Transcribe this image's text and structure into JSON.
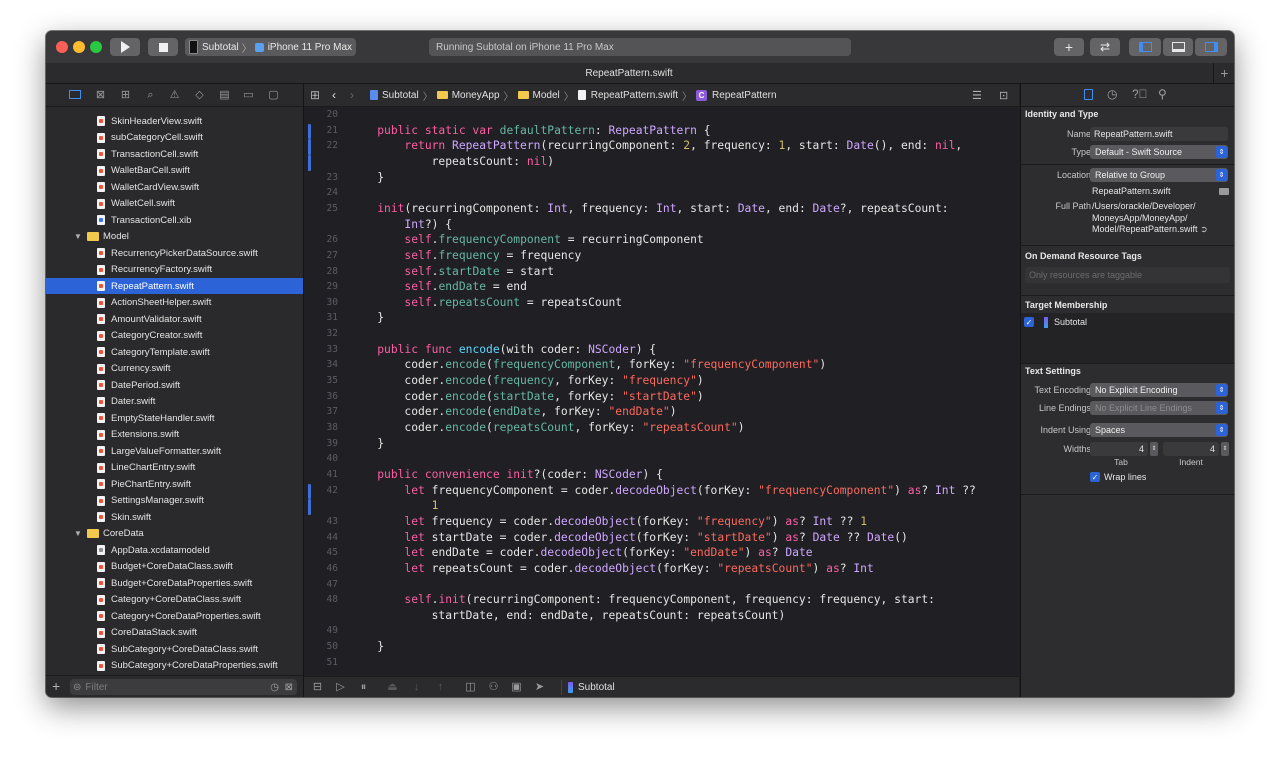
{
  "toolbar": {
    "scheme": "Subtotal",
    "device": "iPhone 11 Pro Max",
    "activity": "Running Subtotal on iPhone 11 Pro Max",
    "add_label": "+"
  },
  "tab": {
    "title": "RepeatPattern.swift",
    "add_label": "+"
  },
  "navigator": {
    "filter_placeholder": "Filter",
    "items": [
      {
        "name": "SkinHeaderView.swift",
        "kind": "swift",
        "level": 2,
        "badge": ""
      },
      {
        "name": "subCategoryCell.swift",
        "kind": "swift",
        "level": 2,
        "badge": ""
      },
      {
        "name": "TransactionCell.swift",
        "kind": "swift",
        "level": 2,
        "badge": ""
      },
      {
        "name": "WalletBarCell.swift",
        "kind": "swift",
        "level": 2,
        "badge": ""
      },
      {
        "name": "WalletCardView.swift",
        "kind": "swift",
        "level": 2,
        "badge": ""
      },
      {
        "name": "WalletCell.swift",
        "kind": "swift",
        "level": 2,
        "badge": ""
      },
      {
        "name": "TransactionCell.xib",
        "kind": "xib",
        "level": 2,
        "badge": ""
      },
      {
        "name": "Model",
        "kind": "folder",
        "level": 1,
        "badge": ""
      },
      {
        "name": "RecurrencyPickerDataSource.swift",
        "kind": "swift",
        "level": 2,
        "badge": ""
      },
      {
        "name": "RecurrencyFactory.swift",
        "kind": "swift",
        "level": 2,
        "badge": "M"
      },
      {
        "name": "RepeatPattern.swift",
        "kind": "swift",
        "level": 2,
        "badge": "R",
        "selected": true
      },
      {
        "name": "ActionSheetHelper.swift",
        "kind": "swift",
        "level": 2,
        "badge": ""
      },
      {
        "name": "AmountValidator.swift",
        "kind": "swift",
        "level": 2,
        "badge": ""
      },
      {
        "name": "CategoryCreator.swift",
        "kind": "swift",
        "level": 2,
        "badge": ""
      },
      {
        "name": "CategoryTemplate.swift",
        "kind": "swift",
        "level": 2,
        "badge": ""
      },
      {
        "name": "Currency.swift",
        "kind": "swift",
        "level": 2,
        "badge": ""
      },
      {
        "name": "DatePeriod.swift",
        "kind": "swift",
        "level": 2,
        "badge": ""
      },
      {
        "name": "Dater.swift",
        "kind": "swift",
        "level": 2,
        "badge": ""
      },
      {
        "name": "EmptyStateHandler.swift",
        "kind": "swift",
        "level": 2,
        "badge": ""
      },
      {
        "name": "Extensions.swift",
        "kind": "swift",
        "level": 2,
        "badge": ""
      },
      {
        "name": "LargeValueFormatter.swift",
        "kind": "swift",
        "level": 2,
        "badge": ""
      },
      {
        "name": "LineChartEntry.swift",
        "kind": "swift",
        "level": 2,
        "badge": ""
      },
      {
        "name": "PieChartEntry.swift",
        "kind": "swift",
        "level": 2,
        "badge": ""
      },
      {
        "name": "SettingsManager.swift",
        "kind": "swift",
        "level": 2,
        "badge": ""
      },
      {
        "name": "Skin.swift",
        "kind": "swift",
        "level": 2,
        "badge": ""
      },
      {
        "name": "CoreData",
        "kind": "folder",
        "level": 1,
        "badge": ""
      },
      {
        "name": "AppData.xcdatamodeld",
        "kind": "model",
        "level": 2,
        "badge": "M"
      },
      {
        "name": "Budget+CoreDataClass.swift",
        "kind": "swift",
        "level": 2,
        "badge": ""
      },
      {
        "name": "Budget+CoreDataProperties.swift",
        "kind": "swift",
        "level": 2,
        "badge": ""
      },
      {
        "name": "Category+CoreDataClass.swift",
        "kind": "swift",
        "level": 2,
        "badge": ""
      },
      {
        "name": "Category+CoreDataProperties.swift",
        "kind": "swift",
        "level": 2,
        "badge": ""
      },
      {
        "name": "CoreDataStack.swift",
        "kind": "swift",
        "level": 2,
        "badge": "M"
      },
      {
        "name": "SubCategory+CoreDataClass.swift",
        "kind": "swift",
        "level": 2,
        "badge": ""
      },
      {
        "name": "SubCategory+CoreDataProperties.swift",
        "kind": "swift",
        "level": 2,
        "badge": ""
      }
    ]
  },
  "jumpbar": {
    "project": "Subtotal",
    "group1": "MoneyApp",
    "group2": "Model",
    "file": "RepeatPattern.swift",
    "symbol_badge": "C",
    "symbol": "RepeatPattern"
  },
  "editor": {
    "lines": [
      {
        "n": "20",
        "parts": []
      },
      {
        "n": "21",
        "parts": [
          [
            "",
            "    "
          ],
          [
            "kw",
            "public static var "
          ],
          [
            "prop",
            "defaultPattern"
          ],
          [
            "",
            ": "
          ],
          [
            "ty",
            "RepeatPattern"
          ],
          [
            "",
            " {"
          ]
        ],
        "changed": true
      },
      {
        "n": "22",
        "parts": [
          [
            "",
            "        "
          ],
          [
            "kw",
            "return "
          ],
          [
            "ty",
            "RepeatPattern"
          ],
          [
            "",
            "(recurringComponent: "
          ],
          [
            "num",
            "2"
          ],
          [
            "",
            ", frequency: "
          ],
          [
            "num",
            "1"
          ],
          [
            "",
            ", start: "
          ],
          [
            "ty",
            "Date"
          ],
          [
            "",
            "(), end: "
          ],
          [
            "kw",
            "nil"
          ],
          [
            "",
            ","
          ]
        ],
        "changed": true
      },
      {
        "n": "",
        "parts": [
          [
            "",
            "            repeatsCount: "
          ],
          [
            "kw",
            "nil"
          ],
          [
            "",
            ")"
          ]
        ],
        "changed": true
      },
      {
        "n": "23",
        "parts": [
          [
            "",
            "    }"
          ]
        ]
      },
      {
        "n": "24",
        "parts": []
      },
      {
        "n": "25",
        "parts": [
          [
            "",
            "    "
          ],
          [
            "kw",
            "init"
          ],
          [
            "",
            "(recurringComponent: "
          ],
          [
            "ty",
            "Int"
          ],
          [
            "",
            ", frequency: "
          ],
          [
            "ty",
            "Int"
          ],
          [
            "",
            ", start: "
          ],
          [
            "ty",
            "Date"
          ],
          [
            "",
            ", end: "
          ],
          [
            "ty",
            "Date"
          ],
          [
            "",
            "?, repeatsCount:"
          ]
        ]
      },
      {
        "n": "",
        "parts": [
          [
            "",
            "        "
          ],
          [
            "ty",
            "Int"
          ],
          [
            "",
            "?) {"
          ]
        ]
      },
      {
        "n": "26",
        "parts": [
          [
            "",
            "        "
          ],
          [
            "self",
            "self"
          ],
          [
            "",
            "."
          ],
          [
            "prop",
            "frequencyComponent"
          ],
          [
            "",
            " = recurringComponent"
          ]
        ]
      },
      {
        "n": "27",
        "parts": [
          [
            "",
            "        "
          ],
          [
            "self",
            "self"
          ],
          [
            "",
            "."
          ],
          [
            "prop",
            "frequency"
          ],
          [
            "",
            " = frequency"
          ]
        ]
      },
      {
        "n": "28",
        "parts": [
          [
            "",
            "        "
          ],
          [
            "self",
            "self"
          ],
          [
            "",
            "."
          ],
          [
            "prop",
            "startDate"
          ],
          [
            "",
            " = start"
          ]
        ]
      },
      {
        "n": "29",
        "parts": [
          [
            "",
            "        "
          ],
          [
            "self",
            "self"
          ],
          [
            "",
            "."
          ],
          [
            "prop",
            "endDate"
          ],
          [
            "",
            " = end"
          ]
        ]
      },
      {
        "n": "30",
        "parts": [
          [
            "",
            "        "
          ],
          [
            "self",
            "self"
          ],
          [
            "",
            "."
          ],
          [
            "prop",
            "repeatsCount"
          ],
          [
            "",
            " = repeatsCount"
          ]
        ]
      },
      {
        "n": "31",
        "parts": [
          [
            "",
            "    }"
          ]
        ]
      },
      {
        "n": "32",
        "parts": []
      },
      {
        "n": "33",
        "parts": [
          [
            "",
            "    "
          ],
          [
            "kw",
            "public func "
          ],
          [
            "cls",
            "encode"
          ],
          [
            "",
            "(with coder: "
          ],
          [
            "ty",
            "NSCoder"
          ],
          [
            "",
            ") {"
          ]
        ]
      },
      {
        "n": "34",
        "parts": [
          [
            "",
            "        coder."
          ],
          [
            "fn",
            "encode"
          ],
          [
            "",
            "("
          ],
          [
            "prop",
            "frequencyComponent"
          ],
          [
            "",
            ", forKey: "
          ],
          [
            "str",
            "\"frequencyComponent\""
          ],
          [
            "",
            ")"
          ]
        ]
      },
      {
        "n": "35",
        "parts": [
          [
            "",
            "        coder."
          ],
          [
            "fn",
            "encode"
          ],
          [
            "",
            "("
          ],
          [
            "prop",
            "frequency"
          ],
          [
            "",
            ", forKey: "
          ],
          [
            "str",
            "\"frequency\""
          ],
          [
            "",
            ")"
          ]
        ]
      },
      {
        "n": "36",
        "parts": [
          [
            "",
            "        coder."
          ],
          [
            "fn",
            "encode"
          ],
          [
            "",
            "("
          ],
          [
            "prop",
            "startDate"
          ],
          [
            "",
            ", forKey: "
          ],
          [
            "str",
            "\"startDate\""
          ],
          [
            "",
            ")"
          ]
        ]
      },
      {
        "n": "37",
        "parts": [
          [
            "",
            "        coder."
          ],
          [
            "fn",
            "encode"
          ],
          [
            "",
            "("
          ],
          [
            "prop",
            "endDate"
          ],
          [
            "",
            ", forKey: "
          ],
          [
            "str",
            "\"endDate\""
          ],
          [
            "",
            ")"
          ]
        ]
      },
      {
        "n": "38",
        "parts": [
          [
            "",
            "        coder."
          ],
          [
            "fn",
            "encode"
          ],
          [
            "",
            "("
          ],
          [
            "prop",
            "repeatsCount"
          ],
          [
            "",
            ", forKey: "
          ],
          [
            "str",
            "\"repeatsCount\""
          ],
          [
            "",
            ")"
          ]
        ]
      },
      {
        "n": "39",
        "parts": [
          [
            "",
            "    }"
          ]
        ]
      },
      {
        "n": "40",
        "parts": []
      },
      {
        "n": "41",
        "parts": [
          [
            "",
            "    "
          ],
          [
            "kw",
            "public convenience init"
          ],
          [
            "",
            "?(coder: "
          ],
          [
            "ty",
            "NSCoder"
          ],
          [
            "",
            ") {"
          ]
        ]
      },
      {
        "n": "42",
        "parts": [
          [
            "",
            "        "
          ],
          [
            "kw",
            "let "
          ],
          [
            "",
            "frequencyComponent = coder."
          ],
          [
            "ty",
            "decodeObject"
          ],
          [
            "",
            "(forKey: "
          ],
          [
            "str",
            "\"frequencyComponent\""
          ],
          [
            "",
            ") "
          ],
          [
            "kw",
            "as"
          ],
          [
            "",
            "? "
          ],
          [
            "ty",
            "Int"
          ],
          [
            "",
            " ??"
          ]
        ],
        "changed": true
      },
      {
        "n": "",
        "parts": [
          [
            "",
            "            "
          ],
          [
            "num",
            "1"
          ]
        ],
        "changed": true
      },
      {
        "n": "43",
        "parts": [
          [
            "",
            "        "
          ],
          [
            "kw",
            "let "
          ],
          [
            "",
            "frequency = coder."
          ],
          [
            "ty",
            "decodeObject"
          ],
          [
            "",
            "(forKey: "
          ],
          [
            "str",
            "\"frequency\""
          ],
          [
            "",
            ") "
          ],
          [
            "kw",
            "as"
          ],
          [
            "",
            "? "
          ],
          [
            "ty",
            "Int"
          ],
          [
            "",
            " ?? "
          ],
          [
            "num",
            "1"
          ]
        ]
      },
      {
        "n": "44",
        "parts": [
          [
            "",
            "        "
          ],
          [
            "kw",
            "let "
          ],
          [
            "",
            "startDate = coder."
          ],
          [
            "ty",
            "decodeObject"
          ],
          [
            "",
            "(forKey: "
          ],
          [
            "str",
            "\"startDate\""
          ],
          [
            "",
            ") "
          ],
          [
            "kw",
            "as"
          ],
          [
            "",
            "? "
          ],
          [
            "ty",
            "Date"
          ],
          [
            "",
            " ?? "
          ],
          [
            "ty",
            "Date"
          ],
          [
            "",
            "()"
          ]
        ]
      },
      {
        "n": "45",
        "parts": [
          [
            "",
            "        "
          ],
          [
            "kw",
            "let "
          ],
          [
            "",
            "endDate = coder."
          ],
          [
            "ty",
            "decodeObject"
          ],
          [
            "",
            "(forKey: "
          ],
          [
            "str",
            "\"endDate\""
          ],
          [
            "",
            ") "
          ],
          [
            "kw",
            "as"
          ],
          [
            "",
            "? "
          ],
          [
            "ty",
            "Date"
          ]
        ]
      },
      {
        "n": "46",
        "parts": [
          [
            "",
            "        "
          ],
          [
            "kw",
            "let "
          ],
          [
            "",
            "repeatsCount = coder."
          ],
          [
            "ty",
            "decodeObject"
          ],
          [
            "",
            "(forKey: "
          ],
          [
            "str",
            "\"repeatsCount\""
          ],
          [
            "",
            ") "
          ],
          [
            "kw",
            "as"
          ],
          [
            "",
            "? "
          ],
          [
            "ty",
            "Int"
          ]
        ]
      },
      {
        "n": "47",
        "parts": []
      },
      {
        "n": "48",
        "parts": [
          [
            "",
            "        "
          ],
          [
            "self",
            "self"
          ],
          [
            "",
            "."
          ],
          [
            "kw",
            "init"
          ],
          [
            "",
            "(recurringComponent: frequencyComponent, frequency: frequency, start:"
          ]
        ]
      },
      {
        "n": "",
        "parts": [
          [
            "",
            "            startDate, end: endDate, repeatsCount: repeatsCount)"
          ]
        ]
      },
      {
        "n": "49",
        "parts": []
      },
      {
        "n": "50",
        "parts": [
          [
            "",
            "    }"
          ]
        ]
      },
      {
        "n": "51",
        "parts": []
      }
    ]
  },
  "debugbar": {
    "scheme": "Subtotal"
  },
  "inspector": {
    "identity_title": "Identity and Type",
    "name_label": "Name",
    "name_value": "RepeatPattern.swift",
    "type_label": "Type",
    "type_value": "Default - Swift Source",
    "location_label": "Location",
    "location_value": "Relative to Group",
    "location_file": "RepeatPattern.swift",
    "fullpath_label": "Full Path",
    "fullpath_lines": [
      "/Users/orackle/Developer/",
      "MoneysApp/MoneyApp/",
      "Model/RepeatPattern.swift"
    ],
    "odr_title": "On Demand Resource Tags",
    "odr_placeholder": "Only resources are taggable",
    "target_title": "Target Membership",
    "target_name": "Subtotal",
    "text_title": "Text Settings",
    "encoding_label": "Text Encoding",
    "encoding_value": "No Explicit Encoding",
    "endings_label": "Line Endings",
    "endings_value": "No Explicit Line Endings",
    "indent_label": "Indent Using",
    "indent_value": "Spaces",
    "widths_label": "Widths",
    "tab_value": "4",
    "indent_width_value": "4",
    "tab_caption": "Tab",
    "indent_caption": "Indent",
    "wrap_label": "Wrap lines"
  }
}
